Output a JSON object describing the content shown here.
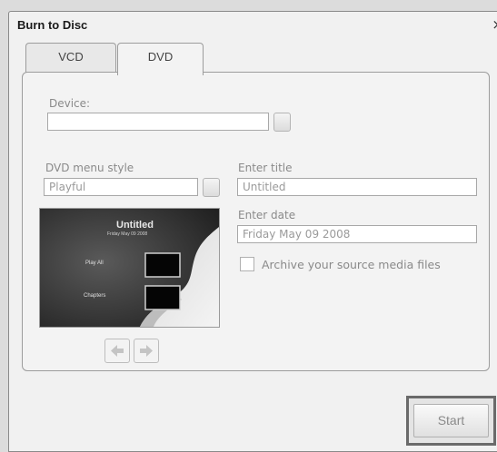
{
  "window": {
    "title": "Burn to Disc",
    "close_glyph": "×"
  },
  "tabs": [
    {
      "label": "VCD",
      "active": false
    },
    {
      "label": "DVD",
      "active": true
    }
  ],
  "device": {
    "label": "Device:",
    "value": ""
  },
  "menu_style": {
    "label": "DVD menu style",
    "value": "Playful"
  },
  "title_field": {
    "label": "Enter title",
    "value": "Untitled"
  },
  "date_field": {
    "label": "Enter date",
    "value": "Friday  May 09  2008"
  },
  "archive": {
    "label": "Archive your source media files",
    "checked": false
  },
  "preview": {
    "title": "Untitled",
    "date": "Friday  May 09  2008",
    "play_all": "Play All",
    "chapters": "Chapters"
  },
  "nav": {
    "prev_icon": "arrow-left-icon",
    "next_icon": "arrow-right-icon"
  },
  "start_label": "Start"
}
